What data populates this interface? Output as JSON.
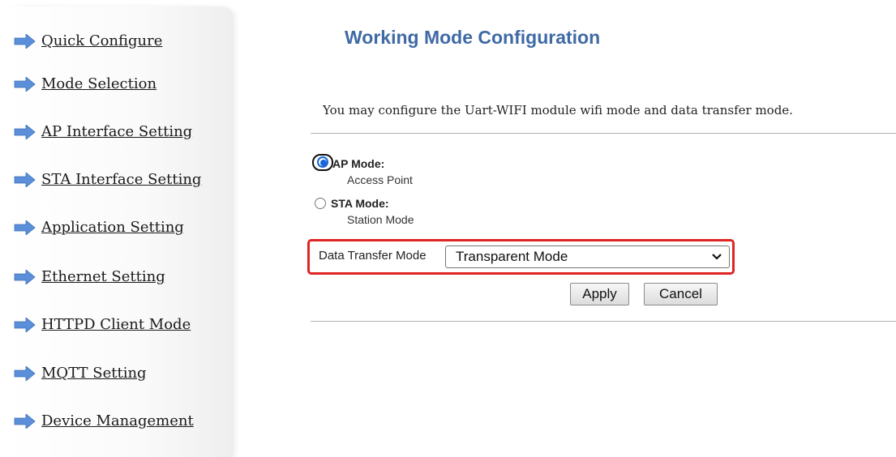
{
  "sidebar": {
    "items": [
      {
        "label": "Quick Configure"
      },
      {
        "label": "Mode Selection"
      },
      {
        "label": "AP Interface Setting"
      },
      {
        "label": "STA Interface Setting"
      },
      {
        "label": "Application Setting"
      },
      {
        "label": "Ethernet Setting"
      },
      {
        "label": "HTTPD Client Mode"
      },
      {
        "label": "MQTT Setting"
      },
      {
        "label": "Device Management"
      }
    ]
  },
  "main": {
    "title": "Working Mode Configuration",
    "intro": "You may configure the Uart-WIFI module wifi mode and data transfer mode.",
    "modes": [
      {
        "label": "AP Mode:",
        "description": "Access Point",
        "selected": true
      },
      {
        "label": "STA Mode:",
        "description": "Station Mode",
        "selected": false
      }
    ],
    "data_transfer": {
      "label": "Data Transfer Mode",
      "selected_value": "Transparent Mode"
    },
    "buttons": {
      "apply": "Apply",
      "cancel": "Cancel"
    }
  },
  "colors": {
    "title": "#3f6aa5",
    "arrow": "#5b8fd9",
    "highlight_border": "#e02424",
    "radio_selected": "#1765d6"
  }
}
